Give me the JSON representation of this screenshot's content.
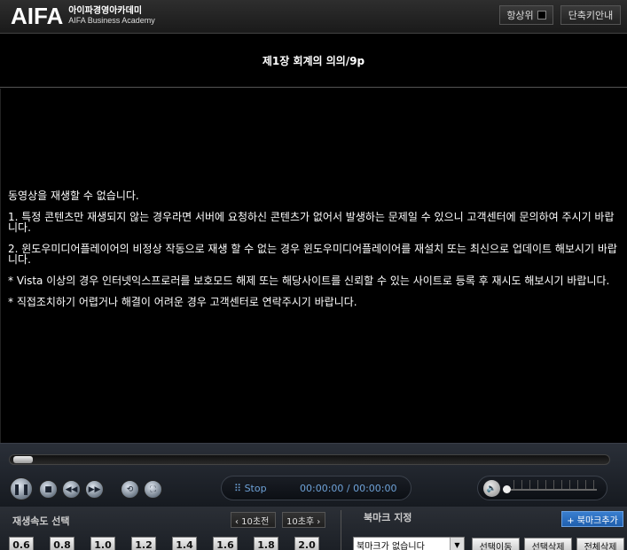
{
  "header": {
    "logo": "AIFA",
    "logo_ko": "아이파경영아카데미",
    "logo_en": "AIFA Business Academy",
    "always_on_top": "항상위",
    "shortcut_guide": "단축키안내"
  },
  "title": "제1장 회계의 의의/9p",
  "message": {
    "line0": "동영상을 재생할 수 없습니다.",
    "line1": "1. 특정 콘텐츠만 재생되지 않는 경우라면 서버에 요청하신 콘텐츠가 없어서 발생하는 문제일 수 있으니 고객센터에 문의하여 주시기 바랍니다.",
    "line2": "2. 윈도우미디어플레이어의 비정상 작동으로 재생 할 수 없는 경우 윈도우미디어플레이어를 재설치 또는 최신으로 업데이트 해보시기 바랍니다.",
    "line3": "* Vista 이상의 경우 인터넷익스프로러를 보호모드 해제 또는 해당사이트를 신뢰할 수 있는 사이트로 등록 후 재시도 해보시기 바랍니다.",
    "line4": "* 직접조치하기 어렵거나 해결이 어려운 경우 고객센터로 연락주시기 바랍니다."
  },
  "player": {
    "stop_label": "Stop",
    "time": "00:00:00 / 00:00:00",
    "progress": 0,
    "volume": 0
  },
  "speed": {
    "title": "재생속도 선택",
    "back": "‹ 10초전",
    "forward": "10초후 ›",
    "options": [
      "0.6",
      "0.8",
      "1.0",
      "1.2",
      "1.4",
      "1.6",
      "1.8",
      "2.0"
    ]
  },
  "bookmark": {
    "title": "북마크 지정",
    "add": "+ 북마크추가",
    "select_value": "북마크가 없습니다",
    "move": "선택이동",
    "delete_selected": "선택삭제",
    "delete_all": "전체삭제"
  }
}
